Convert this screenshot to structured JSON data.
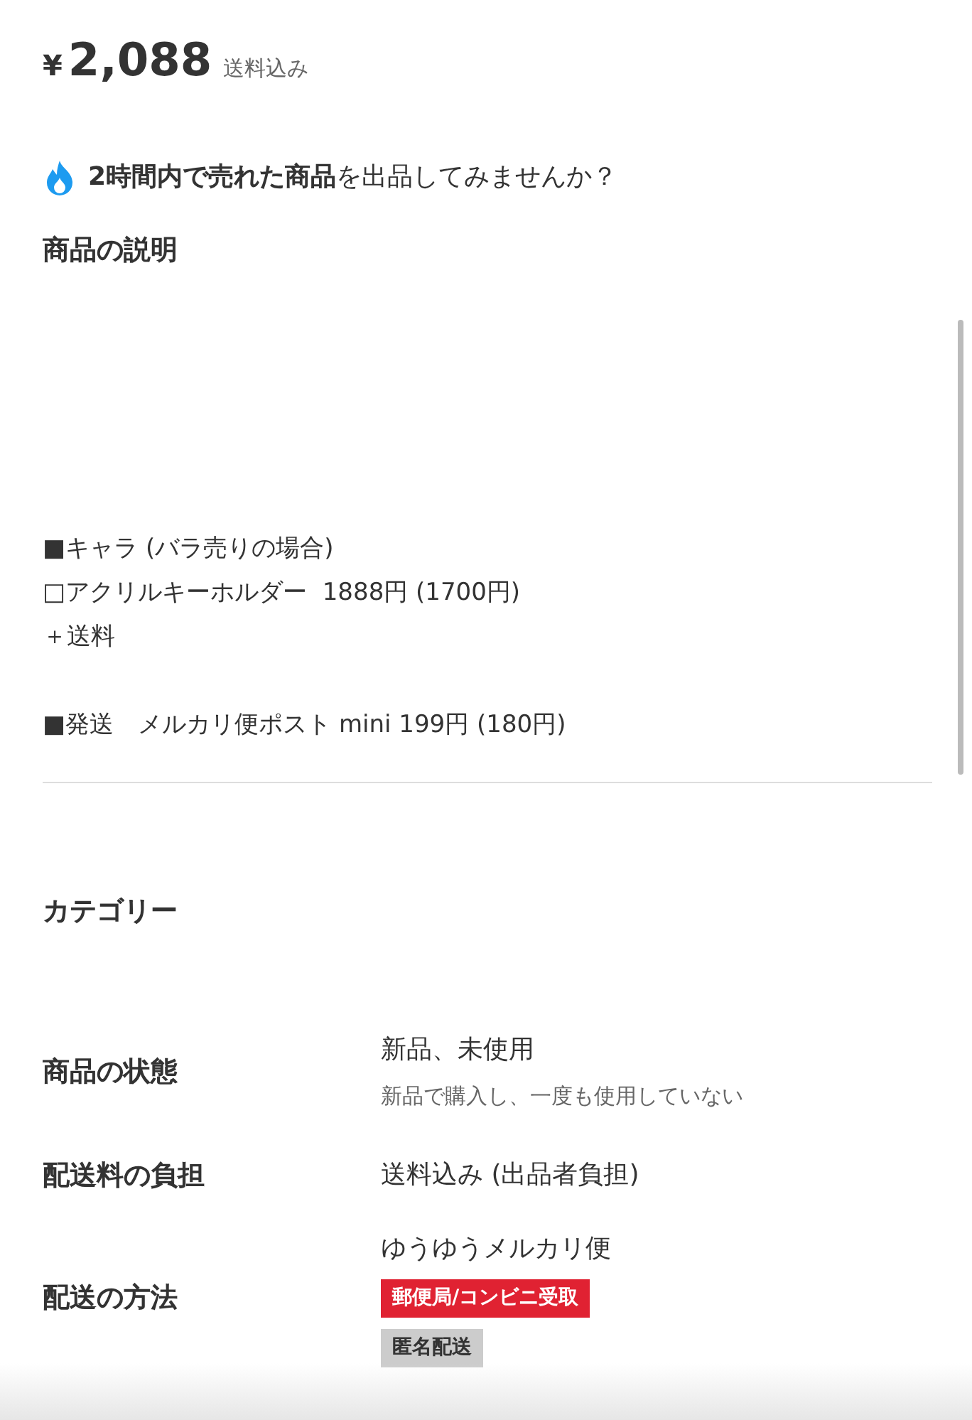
{
  "price": {
    "currency": "¥",
    "amount": "2,088",
    "shipping_note": "送料込み"
  },
  "promo": {
    "text": "**2時間内で売れた商品**を出品してみませんか？"
  },
  "description": {
    "heading": "商品の説明",
    "paragraphs": [
      [
        "■キャラ (バラ売りの場合)",
        "□アクリルキーホルダー  1888円 (1700円)",
        "＋送料"
      ],
      [
        "■発送　メルカリ便ポスト mini 199円 (180円)"
      ]
    ]
  },
  "category": {
    "heading": "カテゴリー"
  },
  "details": [
    {
      "label": "商品の状態",
      "value": "新品、未使用",
      "note": "新品で購入し、一度も使用していない"
    },
    {
      "label": "配送料の負担",
      "value": "送料込み (出品者負担)"
    },
    {
      "label": "配送の方法",
      "value": "ゆうゆうメルカリ便",
      "tags": [
        {
          "text": "郵便局/コンビニ受取",
          "kind": "red"
        },
        {
          "text": "匿名配送",
          "kind": "grey"
        }
      ]
    }
  ]
}
